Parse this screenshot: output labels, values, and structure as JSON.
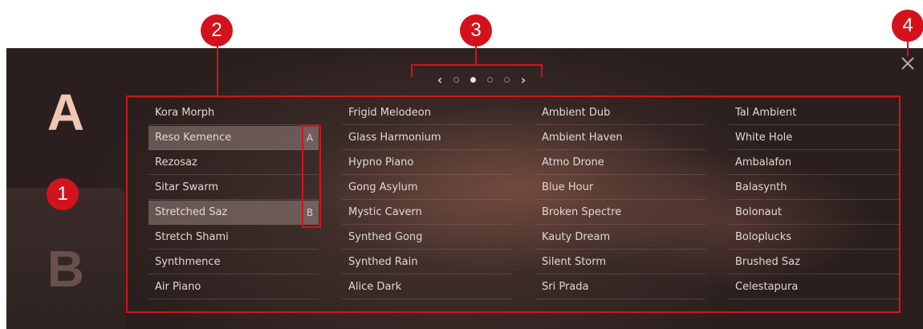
{
  "slots": {
    "a_label": "A",
    "b_label": "B"
  },
  "pager": {
    "prev_icon": "chevron-left-icon",
    "next_icon": "chevron-right-icon",
    "page_count": 4,
    "active_page": 2
  },
  "close_icon": "close-icon",
  "presets": {
    "column_1": [
      "Kora Morph",
      "Reso Kemence",
      "Rezosaz",
      "Sitar Swarm",
      "Stretched Saz",
      "Stretch Shami",
      "Synthmence",
      "Air Piano"
    ],
    "column_2": [
      "Frigid Melodeon",
      "Glass Harmonium",
      "Hypno Piano",
      "Gong Asylum",
      "Mystic Cavern",
      "Synthed Gong",
      "Synthed Rain",
      "Alice Dark"
    ],
    "column_3": [
      "Ambient Dub",
      "Ambient Haven",
      "Atmo Drone",
      "Blue Hour",
      "Broken Spectre",
      "Kauty Dream",
      "Silent Storm",
      "Sri Prada"
    ],
    "column_4": [
      "Tal Ambient",
      "White Hole",
      "Ambalafon",
      "Balasynth",
      "Bolonaut",
      "Boloplucks",
      "Brushed Saz",
      "Celestapura"
    ]
  },
  "assigned": {
    "slot_a": {
      "preset": "Reso Kemence",
      "badge": "A"
    },
    "slot_b": {
      "preset": "Stretched Saz",
      "badge": "B"
    }
  },
  "callouts": [
    "1",
    "2",
    "3",
    "4"
  ],
  "colors": {
    "callout_red": "#d3131b",
    "slot_a_letter": "#f1c6b3",
    "slot_b_letter": "#6a504b",
    "panel_bg": "#2e2322"
  }
}
